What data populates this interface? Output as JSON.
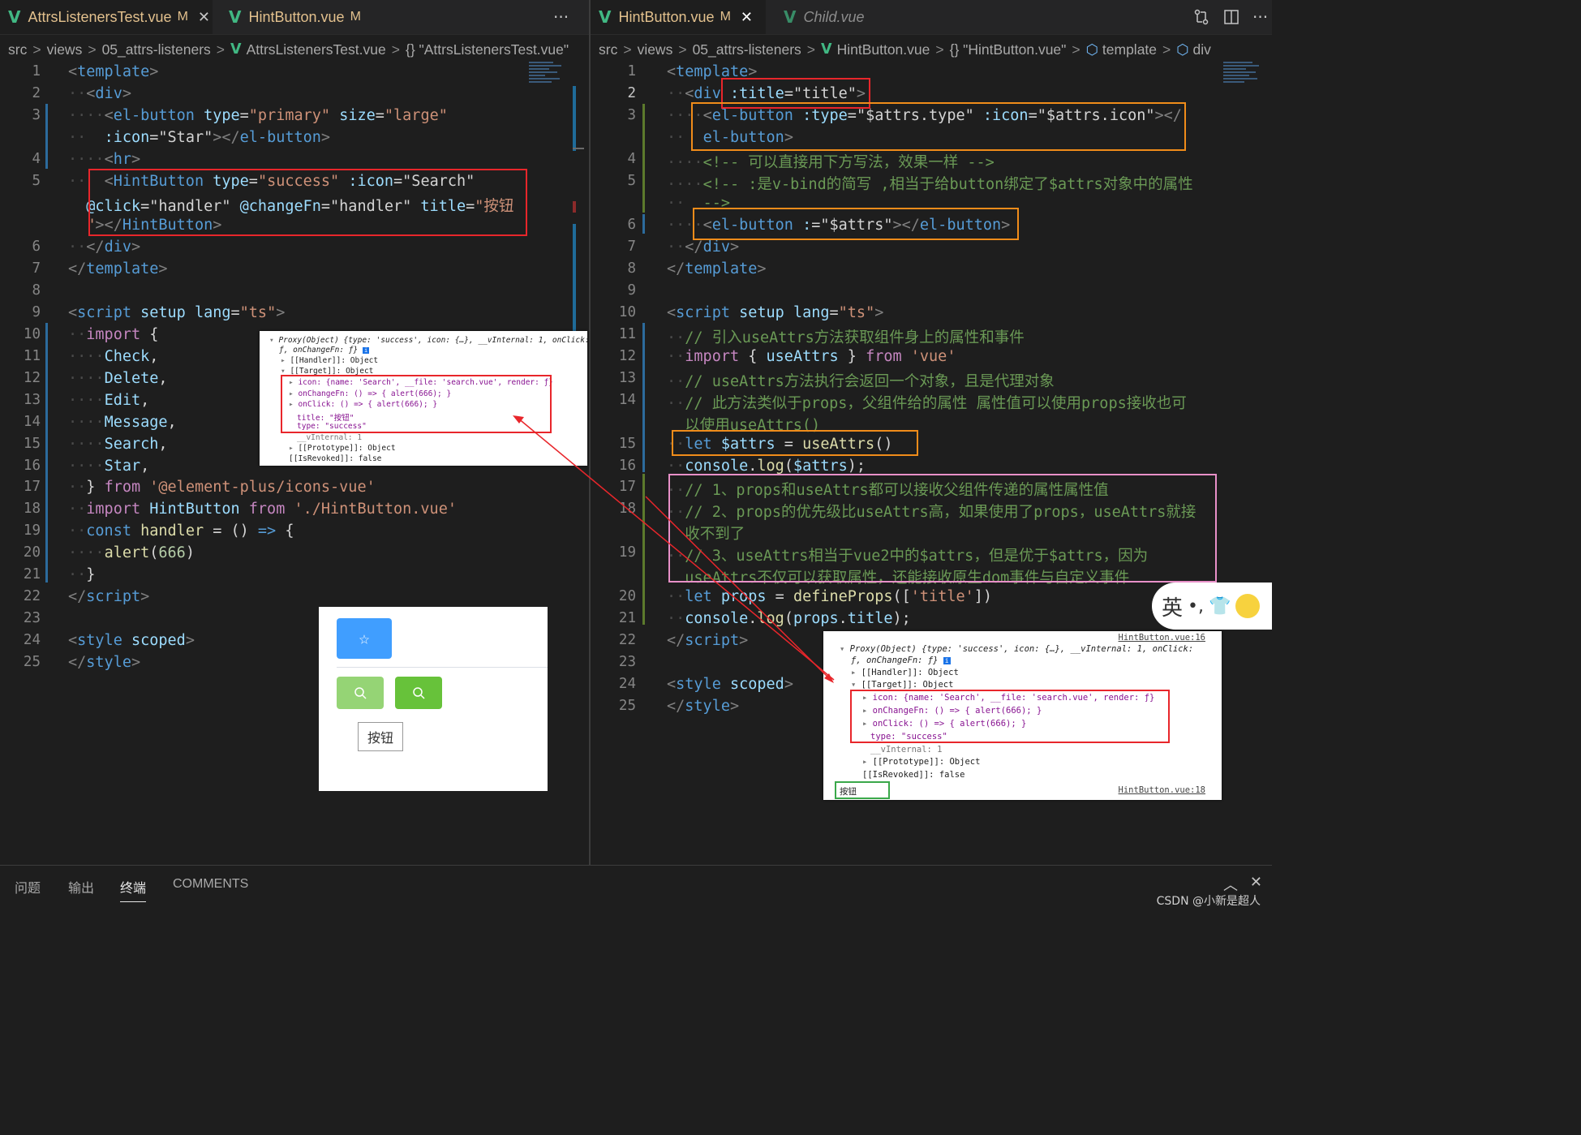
{
  "left": {
    "tabs": [
      {
        "icon": "V",
        "name": "AttrsListenersTest.vue",
        "modified": "M",
        "close": "✕"
      },
      {
        "icon": "V",
        "name": "HintButton.vue",
        "modified": "M"
      }
    ],
    "more": "···",
    "breadcrumb": [
      "src",
      "views",
      "05_attrs-listeners",
      "AttrsListenersTest.vue",
      "{} \"AttrsListenersTest.vue\""
    ],
    "line_numbers": [
      "1",
      "2",
      "3",
      "4",
      "5",
      "6",
      "7",
      "8",
      "9",
      "10",
      "11",
      "12",
      "13",
      "14",
      "15",
      "16",
      "17",
      "18",
      "19",
      "20",
      "21",
      "22",
      "23",
      "24",
      "25"
    ]
  },
  "right": {
    "tabs": [
      {
        "icon": "V",
        "name": "HintButton.vue",
        "modified": "M",
        "close": "✕"
      },
      {
        "icon": "V",
        "name": "Child.vue"
      }
    ],
    "breadcrumb": [
      "src",
      "views",
      "05_attrs-listeners",
      "HintButton.vue",
      "{} \"HintButton.vue\"",
      "template",
      "div"
    ],
    "line_numbers": [
      "1",
      "2",
      "3",
      "4",
      "5",
      "6",
      "7",
      "8",
      "9",
      "10",
      "11",
      "12",
      "13",
      "14",
      "15",
      "16",
      "17",
      "18",
      "19",
      "20",
      "21",
      "22",
      "23",
      "24",
      "25"
    ]
  },
  "console_left": {
    "header": "Proxy(Object) {type: 'success', icon: {…}, __vInternal: 1, onClick:",
    "header2": "ƒ, onChangeFn: ƒ}",
    "handler": "[[Handler]]: Object",
    "target": "[[Target]]: Object",
    "icon": "icon: {name: 'Search', __file: 'search.vue', render: ƒ}",
    "onChangeFn": "onChangeFn: () => { alert(666); }",
    "onClick": "onClick: () => { alert(666); }",
    "title": "title: \"按钮\"",
    "type": "type: \"success\"",
    "vinternal": "__vInternal: 1",
    "prototype": "[[Prototype]]: Object",
    "revoked": "[[IsRevoked]]: false"
  },
  "console_right": {
    "source1": "HintButton.vue:16",
    "header": "Proxy(Object) {type: 'success', icon: {…}, __vInternal: 1, onClick:",
    "header2": "ƒ, onChangeFn: ƒ}",
    "handler": "[[Handler]]: Object",
    "target": "[[Target]]: Object",
    "icon": "icon: {name: 'Search', __file: 'search.vue', render: ƒ}",
    "onChangeFn": "onChangeFn: () => { alert(666); }",
    "onClick": "onClick: () => { alert(666); }",
    "type": "type: \"success\"",
    "vinternal": "__vInternal: 1",
    "prototype": "[[Prototype]]: Object",
    "revoked": "[[IsRevoked]]: false",
    "log_value": "按钮",
    "source2": "HintButton.vue:18"
  },
  "preview": {
    "star_icon": "☆",
    "search_icon": "⌕",
    "button_label": "按钮"
  },
  "panel_tabs": [
    "问题",
    "输出",
    "终端",
    "COMMENTS"
  ],
  "ime": "英",
  "watermark": "CSDN @小新是超人",
  "colors": {
    "red_box": "#e8262b",
    "orange_box": "#f08c1a",
    "pink_box": "#e890c8",
    "vue_green": "#41b883"
  }
}
